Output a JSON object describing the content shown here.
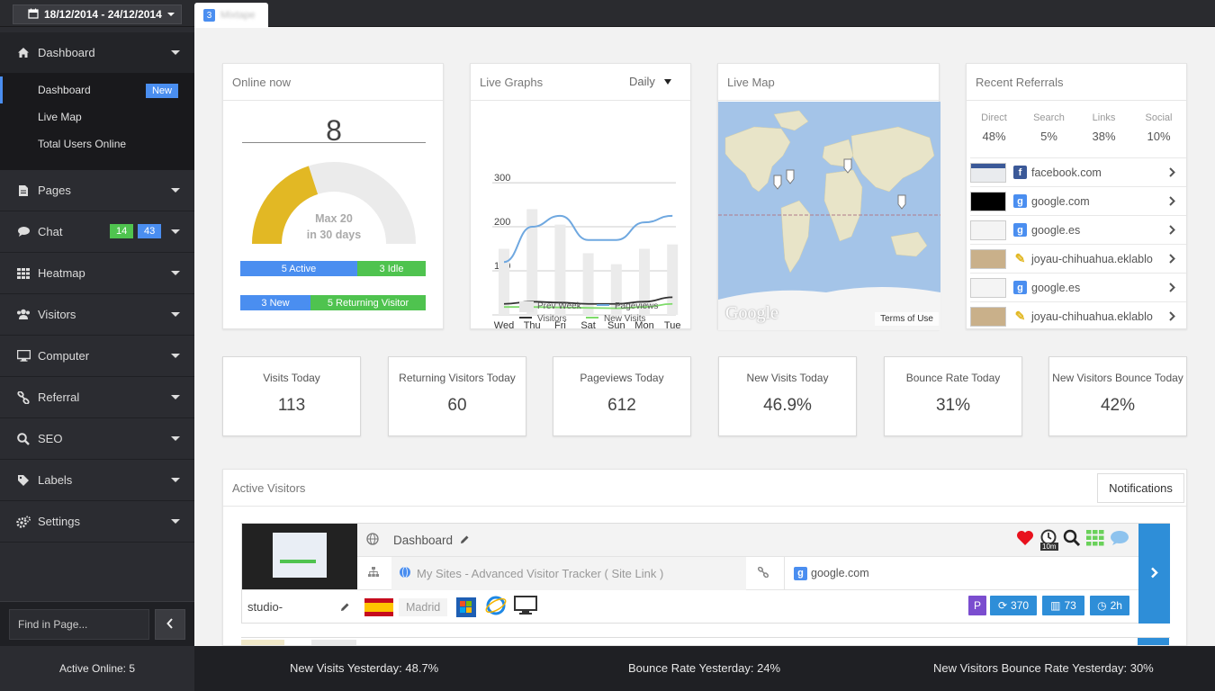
{
  "topbar": {
    "date_range": "18/12/2014 - 24/12/2014",
    "tab_number": "3",
    "tab_label": "Mixtape"
  },
  "sidebar": {
    "items": [
      {
        "label": "Dashboard",
        "icon": "home-icon"
      },
      {
        "label": "Pages",
        "icon": "file-icon"
      },
      {
        "label": "Chat",
        "icon": "chat-icon",
        "badge_green": "14",
        "badge_blue": "43"
      },
      {
        "label": "Heatmap",
        "icon": "grid-icon"
      },
      {
        "label": "Visitors",
        "icon": "users-icon"
      },
      {
        "label": "Computer",
        "icon": "monitor-icon"
      },
      {
        "label": "Referral",
        "icon": "link-icon"
      },
      {
        "label": "SEO",
        "icon": "search-icon"
      },
      {
        "label": "Labels",
        "icon": "tag-icon"
      },
      {
        "label": "Settings",
        "icon": "gear-icon"
      }
    ],
    "subitems": [
      {
        "label": "Dashboard",
        "badge": "New"
      },
      {
        "label": "Live Map"
      },
      {
        "label": "Total Users Online"
      }
    ],
    "find_placeholder": "Find in Page..."
  },
  "online_now": {
    "title": "Online now",
    "count": "8",
    "gauge_max": "Max 20",
    "gauge_period": "in 30 days",
    "active": "5 Active",
    "idle": "3 Idle",
    "new": "3 New",
    "returning": "5 Returning Visitor",
    "active_fraction": 0.4
  },
  "live_graphs": {
    "title": "Live Graphs",
    "period": "Daily",
    "legend": [
      "Prev Week",
      "Pageviews",
      "Visitors",
      "New Visits"
    ]
  },
  "chart_data": {
    "type": "line",
    "categories": [
      "Wed",
      "Thu",
      "Fri",
      "Sat",
      "Sun",
      "Mon",
      "Tue"
    ],
    "ylim": [
      0,
      300
    ],
    "yticks": [
      100,
      200,
      300
    ],
    "bar_series": {
      "name": "Prev Week",
      "values": [
        150,
        240,
        205,
        140,
        115,
        150,
        160
      ]
    },
    "series": [
      {
        "name": "Pageviews",
        "values": [
          120,
          200,
          225,
          170,
          170,
          210,
          225
        ]
      },
      {
        "name": "Visitors",
        "values": [
          25,
          30,
          28,
          25,
          25,
          30,
          40
        ]
      },
      {
        "name": "New Visits",
        "values": [
          18,
          18,
          17,
          16,
          15,
          18,
          25
        ]
      }
    ]
  },
  "live_map": {
    "title": "Live Map",
    "terms": "Terms of Use",
    "brand": "Google"
  },
  "referrals": {
    "title": "Recent Referrals",
    "stats": [
      {
        "label": "Direct",
        "value": "48%"
      },
      {
        "label": "Search",
        "value": "5%"
      },
      {
        "label": "Links",
        "value": "38%"
      },
      {
        "label": "Social",
        "value": "10%"
      }
    ],
    "rows": [
      {
        "site": "facebook.com",
        "icon": "facebook-icon"
      },
      {
        "site": "google.com",
        "icon": "google-icon"
      },
      {
        "site": "google.es",
        "icon": "google-icon"
      },
      {
        "site": "joyau-chihuahua.eklablo",
        "icon": "pencil-icon"
      },
      {
        "site": "google.es",
        "icon": "google-icon"
      },
      {
        "site": "joyau-chihuahua.eklablo",
        "icon": "pencil-icon"
      }
    ]
  },
  "stats": [
    {
      "label": "Visits Today",
      "value": "113"
    },
    {
      "label": "Returning Visitors Today",
      "value": "60"
    },
    {
      "label": "Pageviews Today",
      "value": "612"
    },
    {
      "label": "New Visits Today",
      "value": "46.9%"
    },
    {
      "label": "Bounce Rate Today",
      "value": "31%"
    },
    {
      "label": "New Visitors Bounce Today",
      "value": "42%"
    }
  ],
  "active_visitors": {
    "title": "Active Visitors",
    "notifications_label": "Notifications",
    "visitor": {
      "page": "Dashboard",
      "site_link": "My Sites - Advanced Visitor Tracker ( Site Link )",
      "referrer": "google.com",
      "name": "studio-",
      "city": "Madrid",
      "idle_badge": "10m",
      "p_label": "P",
      "refresh_count": "370",
      "chart_count": "73",
      "time": "2h"
    }
  },
  "bottombar": {
    "active_online": "Active Online: 5",
    "new_visits_yesterday": "New Visits Yesterday: 48.7%",
    "bounce_rate_yesterday": "Bounce Rate Yesterday: 24%",
    "new_visitors_bounce_yesterday": "New Visitors Bounce Rate Yesterday: 30%"
  }
}
